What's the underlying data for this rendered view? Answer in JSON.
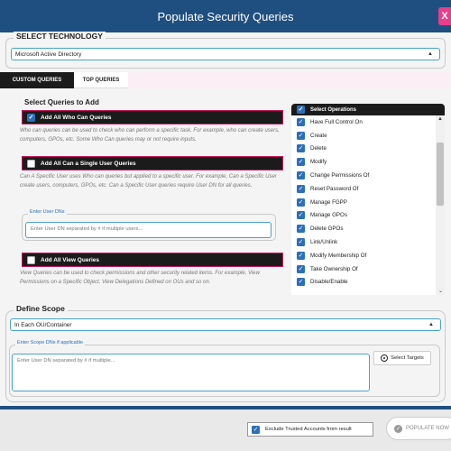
{
  "window": {
    "title": "Populate Security Queries",
    "close_label": "X"
  },
  "technology": {
    "legend": "SELECT TECHNOLOGY",
    "selected": "Microsoft Active Directory"
  },
  "tabs": [
    {
      "label": "CUSTOM QUERIES",
      "active": true
    },
    {
      "label": "TOP QUERIES",
      "active": false
    }
  ],
  "queries": {
    "legend": "Select Queries to Add",
    "who_can": {
      "label": "Add All Who Can Queries",
      "checked": true,
      "description": "Who can queries can be used to check who can perform a specific task. For example, who can create users, computers, GPOs, etc. Some Who Can queries may or not require inputs."
    },
    "single_user": {
      "label": "Add All Can a Single User Queries",
      "checked": false,
      "description": "Can A Specific User uses Who can queries but applied to a specific user. For example, Can a Specific User create users, computers, GPOs, etc. Can a Specific User queries require User DN for all queries."
    },
    "user_dns": {
      "legend": "Enter User DNs",
      "placeholder": "Enter User DN separated by # if multiple users..."
    },
    "view": {
      "label": "Add All View Queries",
      "checked": false,
      "description": "View Queries can be used to check permissions and other security related items. For example, View Permissions on a Specific Object, View Delegations Defined on OUs and so on."
    }
  },
  "operations": {
    "header": "Select Operations",
    "items": [
      "Have Full Control On",
      "Create",
      "Delete",
      "Modify",
      "Change Permissions Of",
      "Reset Password Of",
      "Manage FGPP",
      "Manage GPOs",
      "Delete GPOs",
      "Link/Unlink",
      "Modify Membership Of",
      "Take Ownership Of",
      "Disable/Enable"
    ]
  },
  "scope": {
    "legend": "Define Scope",
    "selected": "In Each OU/Container",
    "dns_legend": "Enter Scope DNs if applicable",
    "placeholder": "Enter User DN separated by # if multiple...",
    "targets_label": "Select Targets"
  },
  "footer": {
    "exclude_label": "Exclude Trusted Accounts from result",
    "populate_label": "POPULATE NOW"
  }
}
